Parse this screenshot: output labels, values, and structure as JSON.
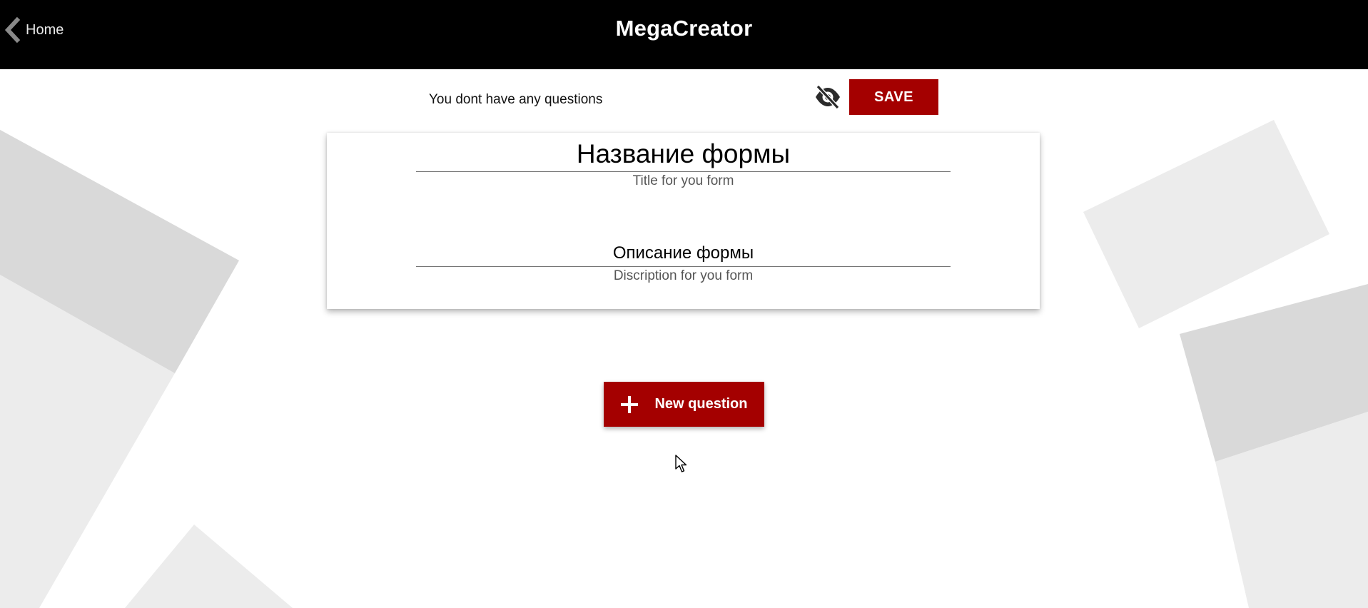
{
  "header": {
    "back_label": "Home",
    "app_title": "MegaCreator",
    "back_icon": "chevron-left-icon"
  },
  "toolbar": {
    "status_text": "You dont have any questions",
    "visibility_icon": "eye-off-icon",
    "save_label": "SAVE"
  },
  "form": {
    "title_value": "Название формы",
    "title_hint": "Title for you form",
    "description_value": "Описание формы",
    "description_hint": "Discription for you form"
  },
  "actions": {
    "new_question_label": "New question",
    "new_question_icon": "plus-icon"
  },
  "colors": {
    "header_bg": "#000000",
    "accent": "#a40000",
    "background": "#ffffff",
    "shape_light": "#ececec",
    "shape_dark": "#d9d9d9"
  }
}
